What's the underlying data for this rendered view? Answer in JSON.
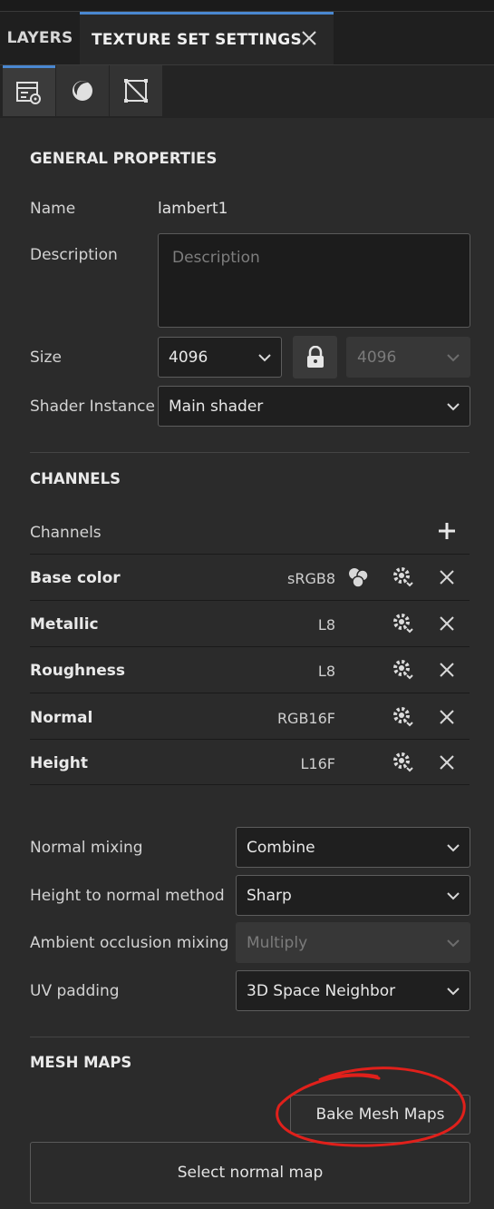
{
  "tabs": {
    "layers_label": "LAYERS",
    "tss_label": "TEXTURE SET SETTINGS"
  },
  "icons": {
    "settings": "list-settings-icon",
    "material": "material-ball-icon",
    "mesh": "mesh-uv-icon"
  },
  "general": {
    "header": "GENERAL PROPERTIES",
    "name_label": "Name",
    "name_value": "lambert1",
    "description_label": "Description",
    "description_placeholder": "Description",
    "size_label": "Size",
    "size_value": "4096",
    "size_locked_value": "4096",
    "shader_label": "Shader Instance",
    "shader_value": "Main shader"
  },
  "channels": {
    "header": "CHANNELS",
    "list_label": "Channels",
    "items": [
      {
        "name": "Base color",
        "format": "sRGB8",
        "has_color_icon": true
      },
      {
        "name": "Metallic",
        "format": "L8"
      },
      {
        "name": "Roughness",
        "format": "L8"
      },
      {
        "name": "Normal",
        "format": "RGB16F"
      },
      {
        "name": "Height",
        "format": "L16F"
      }
    ]
  },
  "mixing": {
    "normal_mixing_label": "Normal mixing",
    "normal_mixing_value": "Combine",
    "height_method_label": "Height to normal method",
    "height_method_value": "Sharp",
    "ao_mixing_label": "Ambient occlusion mixing",
    "ao_mixing_value": "Multiply",
    "uv_padding_label": "UV padding",
    "uv_padding_value": "3D Space Neighbor"
  },
  "mesh_maps": {
    "header": "MESH MAPS",
    "bake_button": "Bake Mesh Maps",
    "select_normal": "Select normal map"
  },
  "colors": {
    "accent": "#4a88d1",
    "annotation": "#e0201b",
    "background": "#2b2b2b"
  }
}
